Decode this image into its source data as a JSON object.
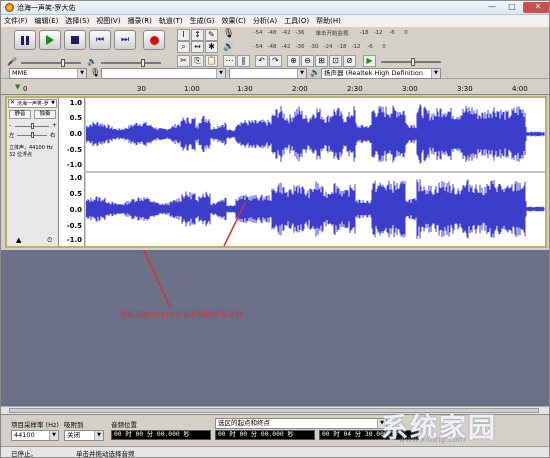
{
  "window": {
    "title": "沧海一声笑-罗大佑",
    "min": "—",
    "max": "□",
    "close": "✕"
  },
  "menu": [
    "文件(F)",
    "编辑(E)",
    "选择(S)",
    "视图(V)",
    "播录(R)",
    "轨道(T)",
    "生成(G)",
    "效果(C)",
    "分析(A)",
    "工具(O)",
    "帮助(H)"
  ],
  "meter_ticks_top": [
    "-54",
    "-48",
    "-42",
    "-36",
    "单击开始监视",
    "-18",
    "-12",
    "-6",
    "0"
  ],
  "meter_ticks_bottom": [
    "-54",
    "-48",
    "-42",
    "-36",
    "-30",
    "-24",
    "-18",
    "-12",
    "-6",
    "0"
  ],
  "device": {
    "host": "MME",
    "output": "扬声器 (Realtek High Definition"
  },
  "ruler": {
    "ticks": [
      "0",
      "30",
      "1:00",
      "1:30",
      "2:00",
      "2:30",
      "3:00",
      "3:30",
      "4:00"
    ]
  },
  "track": {
    "name": "沧海一声笑-罗",
    "mute": "静音",
    "solo": "独奏",
    "gain_l": "-",
    "gain_r": "+",
    "pan_l": "左",
    "pan_r": "右",
    "info1": "立体声，44100 Hz",
    "info2": "32 位浮点"
  },
  "vscale": [
    "1.0",
    "0.5",
    "0.0",
    "-0.5",
    "-1.0"
  ],
  "annotation": "按组和键Ctrl+A全选音频的所有音频",
  "selection": {
    "rate_label": "项目采样率 (Hz)",
    "rate": "44100",
    "snap_label": "吸附到",
    "snap": "关闭",
    "pos_label": "音频位置",
    "pos": "00 时 00 分 00.000 秒",
    "sel_label": "选区的起点和终点",
    "sel_start": "00 时 00 分 00.000 秒",
    "sel_end": "00 时 04 分 30.000 秒"
  },
  "status": {
    "left": "已停止。",
    "right": "单击并拖动选择音频"
  },
  "watermark": {
    "big": "系统家园",
    "small": "www.xitong.com"
  }
}
